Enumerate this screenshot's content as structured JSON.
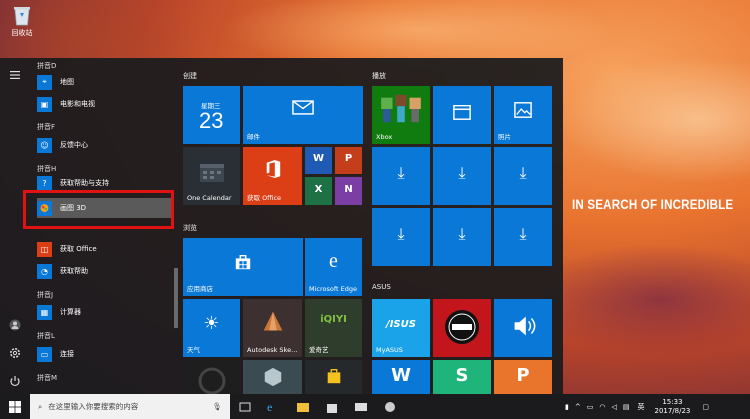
{
  "desktop": {
    "recycle_bin_label": "回收站",
    "tagline": "IN SEARCH OF INCREDIBLE"
  },
  "applist": {
    "groups": [
      {
        "label": "拼音D",
        "apps": [
          "地图",
          "电影和电视"
        ]
      },
      {
        "label": "拼音F",
        "apps": [
          "反馈中心"
        ]
      },
      {
        "label": "拼音H",
        "apps": [
          "获取帮助与支持",
          "画图 3D",
          "获取 Office",
          "获取帮助"
        ]
      },
      {
        "label": "拼音J",
        "apps": [
          "计算器"
        ]
      },
      {
        "label": "拼音L",
        "apps": [
          "连接"
        ]
      },
      {
        "label": "拼音M",
        "apps": []
      }
    ],
    "highlighted": "画图 3D"
  },
  "sections": {
    "create": "创建",
    "play": "播放",
    "browse": "浏览",
    "asus": "ASUS"
  },
  "tiles": {
    "calendar_weekday": "星期三",
    "calendar_day": "23",
    "mail": "邮件",
    "xbox": "Xbox",
    "photos": "照片",
    "one_calendar": "One Calendar",
    "get_office": "获取 Office",
    "store": "应用商店",
    "edge": "Microsoft Edge",
    "weather": "天气",
    "autodesk": "Autodesk Ske…",
    "iqiyi": "爱奇艺",
    "myasus": "MyASUS"
  },
  "taskbar": {
    "search_placeholder": "在这里输入你要搜索的内容",
    "ime": "英",
    "time": "15:33",
    "date": "2017/8/23"
  },
  "colors": {
    "tile_blue": "#0a78d7",
    "office_orange": "#dc3e15",
    "xbox_green": "#107c10",
    "highlight_red": "#e01212"
  }
}
